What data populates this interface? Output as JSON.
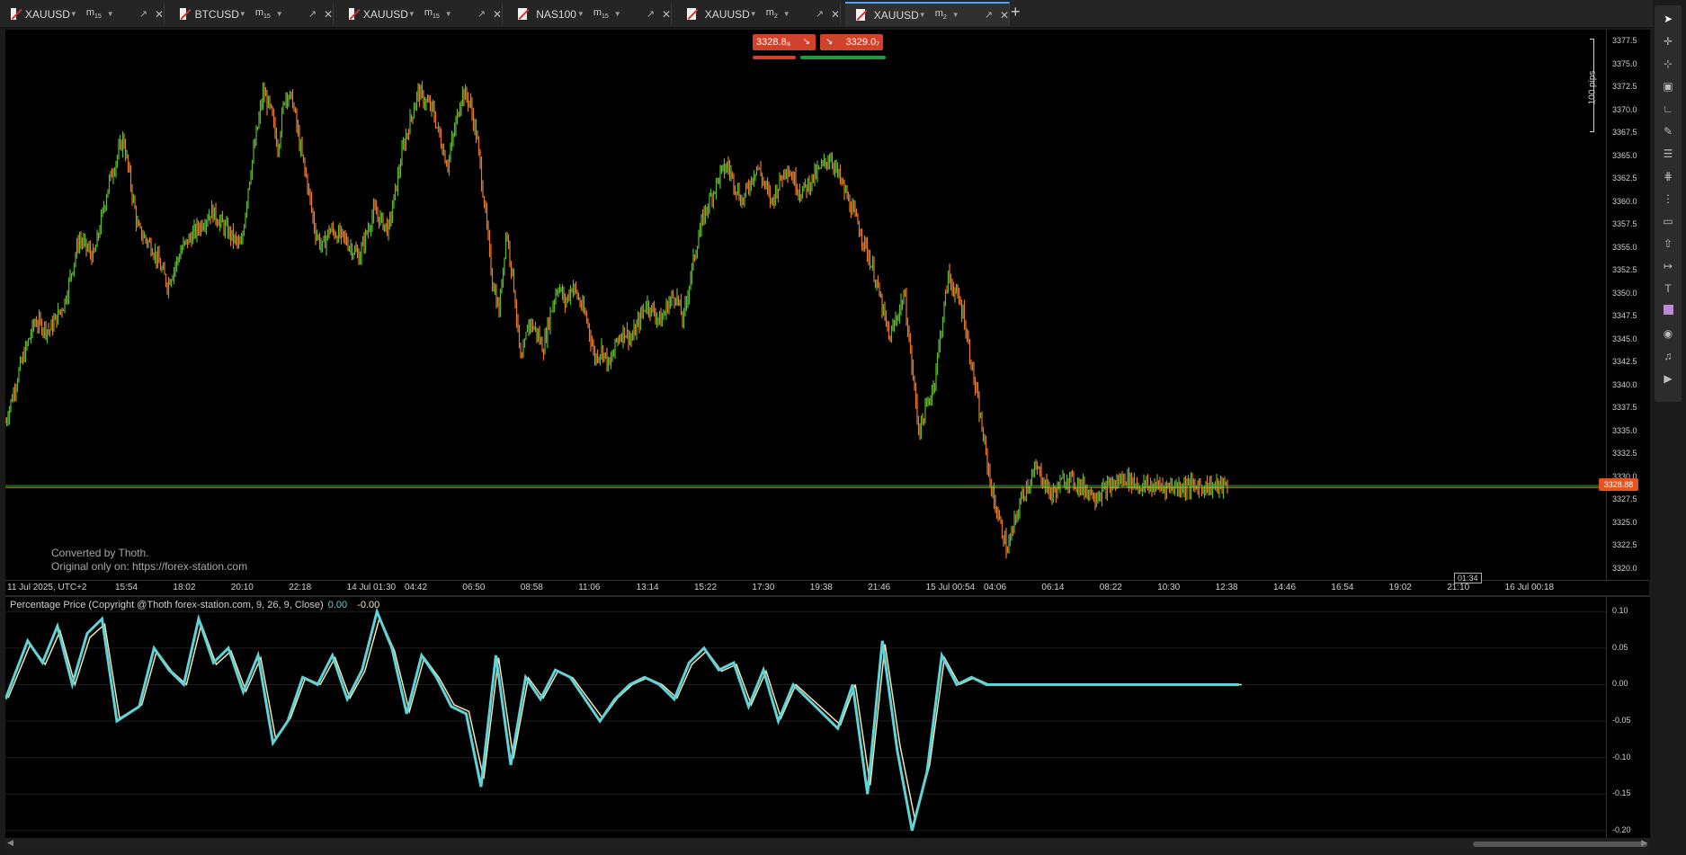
{
  "tabs": [
    {
      "symbol": "XAUUSD",
      "tf": "m",
      "tf_sub": "15",
      "active": false
    },
    {
      "symbol": "BTCUSD",
      "tf": "m",
      "tf_sub": "15",
      "active": false
    },
    {
      "symbol": "XAUUSD",
      "tf": "m",
      "tf_sub": "15",
      "active": false
    },
    {
      "symbol": "NAS100",
      "tf": "m",
      "tf_sub": "15",
      "active": false
    },
    {
      "symbol": "XAUUSD",
      "tf": "m",
      "tf_sub": "2",
      "active": false
    },
    {
      "symbol": "XAUUSD",
      "tf": "m",
      "tf_sub": "2",
      "active": true
    }
  ],
  "add_tab": "+",
  "trade": {
    "sell_price": "3328.8₈",
    "buy_price": "3329.0₇",
    "sell_color": "#d2412a",
    "buy_color": "#1f9a3e"
  },
  "ruler_label": "100 pips",
  "current_price": "3328.88",
  "watermark": [
    "Converted by Thoth.",
    "Original only on: https://forex-station.com"
  ],
  "timer": "01:34",
  "price_axis": [
    "3377.5",
    "3375.0",
    "3372.5",
    "3370.0",
    "3367.5",
    "3365.0",
    "3362.5",
    "3360.0",
    "3357.5",
    "3355.0",
    "3352.5",
    "3350.0",
    "3347.5",
    "3345.0",
    "3342.5",
    "3340.0",
    "3337.5",
    "3335.0",
    "3332.5",
    "3330.0",
    "3327.5",
    "3325.0",
    "3322.5",
    "3320.0"
  ],
  "time_axis": [
    "11 Jul 2025, UTC+2",
    "15:54",
    "18:02",
    "20:10",
    "22:18",
    "14 Jul 01:30",
    "04:42",
    "06:50",
    "08:58",
    "11:06",
    "13:14",
    "15:22",
    "17:30",
    "19:38",
    "21:46",
    "15 Jul 00:54",
    "04:06",
    "06:14",
    "08:22",
    "10:30",
    "12:38",
    "14:46",
    "16:54",
    "19:02",
    "21:10",
    "16 Jul 00:18"
  ],
  "indicator": {
    "label": "Percentage Price (Copyright @Thoth forex-station.com, 9, 26, 9, Close)",
    "value1": "0.00",
    "value2": "-0.00",
    "axis": [
      "0.10",
      "0.05",
      "0.00",
      "-0.05",
      "-0.10",
      "-0.15",
      "-0.20"
    ],
    "line_color": "#5fd3d6",
    "signal_color": "#f4e3b0"
  },
  "colors": {
    "bull": "#5cb82f",
    "bear": "#e8782a",
    "price_line": "#d9a020",
    "ask_line": "#2f9d3e"
  },
  "chart_data": {
    "type": "line",
    "series": [
      {
        "x": [
          0,
          20,
          40,
          60,
          80,
          100,
          120,
          140,
          160,
          170,
          180,
          200,
          220,
          240,
          260,
          280,
          300,
          320,
          330,
          340,
          350,
          360,
          370,
          380,
          390,
          400,
          410,
          420,
          430,
          440,
          460,
          480,
          500,
          520,
          540,
          560,
          580,
          600,
          620,
          630,
          640,
          650,
          660,
          670,
          680,
          690,
          700,
          710,
          720,
          730,
          740,
          750,
          760,
          770,
          780,
          790,
          800,
          810,
          820,
          830,
          840,
          850,
          860,
          870,
          880,
          890,
          900,
          910,
          920,
          930,
          940,
          950,
          960,
          970,
          980,
          990,
          1000,
          1020,
          1040,
          1060,
          1080,
          1100,
          1120,
          1140,
          1160,
          1180,
          1200,
          1220,
          1240,
          1260,
          1280,
          1300,
          1320,
          1340,
          1360,
          1380,
          1400,
          1420,
          1440,
          1460,
          1480,
          1500,
          1520,
          1540,
          1560,
          1570,
          1580,
          1590,
          1600,
          1610,
          1620,
          1630,
          1640,
          1650,
          1660
        ],
        "y": [
          3336,
          3342,
          3347,
          3346,
          3349,
          3356,
          3354,
          3362,
          3367,
          3362,
          3357,
          3355,
          3351,
          3355,
          3357,
          3359,
          3357,
          3355,
          3362,
          3367,
          3372,
          3370,
          3366,
          3372,
          3371,
          3366,
          3362,
          3357,
          3355,
          3357,
          3356,
          3354,
          3359,
          3357,
          3366,
          3372,
          3370,
          3364,
          3372,
          3371,
          3367,
          3360,
          3352,
          3348,
          3357,
          3351,
          3342,
          3347,
          3346,
          3344,
          3348,
          3351,
          3349,
          3351,
          3349,
          3347,
          3343,
          3344,
          3342,
          3345,
          3346,
          3345,
          3347,
          3349,
          3348,
          3347,
          3349,
          3350,
          3347,
          3352,
          3356,
          3359,
          3361,
          3363,
          3364,
          3362,
          3360,
          3364,
          3360,
          3364,
          3361,
          3363,
          3365,
          3361,
          3357,
          3352,
          3345,
          3350,
          3335,
          3340,
          3352,
          3348,
          3338,
          3328,
          3322,
          3328,
          3331,
          3328,
          3330,
          3329,
          3328,
          3329,
          3330,
          3329,
          3329,
          3329,
          3329,
          3329,
          3329,
          3329,
          3329,
          3329,
          3329,
          3329,
          3329
        ]
      },
      {
        "x": [
          0,
          30,
          50,
          70,
          90,
          110,
          130,
          150,
          180,
          200,
          220,
          240,
          260,
          280,
          300,
          320,
          340,
          360,
          380,
          400,
          420,
          440,
          460,
          480,
          500,
          520,
          540,
          560,
          580,
          600,
          620,
          640,
          660,
          680,
          700,
          720,
          740,
          760,
          780,
          800,
          820,
          840,
          860,
          880,
          900,
          920,
          940,
          960,
          980,
          1000,
          1020,
          1040,
          1060,
          1080,
          1100,
          1120,
          1140,
          1160,
          1180,
          1200,
          1220,
          1240,
          1260,
          1280,
          1300,
          1320,
          1340,
          1360,
          1380,
          1400,
          1420,
          1440,
          1460,
          1480,
          1500,
          1520,
          1540,
          1560,
          1580,
          1600,
          1620,
          1640,
          1660
        ],
        "y": [
          -0.02,
          0.06,
          0.03,
          0.08,
          0.0,
          0.07,
          0.09,
          -0.05,
          -0.03,
          0.05,
          0.02,
          0.0,
          0.09,
          0.03,
          0.05,
          -0.01,
          0.04,
          -0.08,
          -0.05,
          0.01,
          0.0,
          0.04,
          -0.02,
          0.02,
          0.1,
          0.05,
          -0.04,
          0.04,
          0.01,
          -0.03,
          -0.04,
          -0.14,
          0.04,
          -0.11,
          0.01,
          -0.02,
          0.02,
          0.01,
          -0.02,
          -0.05,
          -0.02,
          0.0,
          0.01,
          0.0,
          -0.02,
          0.03,
          0.05,
          0.02,
          0.03,
          -0.03,
          0.02,
          -0.05,
          0.0,
          -0.02,
          -0.04,
          -0.06,
          0.0,
          -0.15,
          0.06,
          -0.09,
          -0.2,
          -0.12,
          0.04,
          0.0,
          0.01,
          0.0,
          0.0,
          0.0,
          0.0,
          0.0,
          0.0,
          0.0,
          0.0,
          0.0,
          0.0,
          0.0,
          0.0,
          0.0,
          0.0,
          0.0,
          0.0,
          0.0,
          0.0
        ]
      }
    ],
    "ylim": [
      3318.8,
      3378.8
    ],
    "y2lim": [
      -0.21,
      0.12
    ]
  }
}
